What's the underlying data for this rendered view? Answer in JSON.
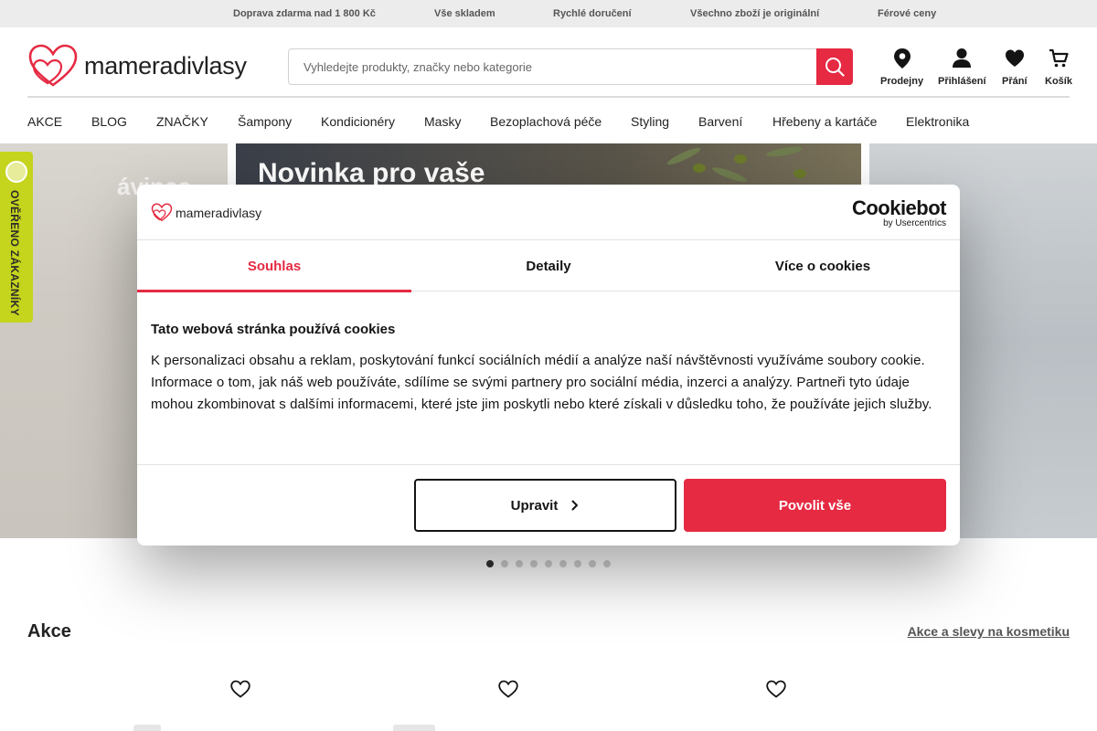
{
  "topbar": {
    "items": [
      "Doprava zdarma nad 1 800 Kč",
      "Vše skladem",
      "Rychlé doručení",
      "Všechno zboží je originální",
      "Férové ceny"
    ]
  },
  "header": {
    "logo_text": "mameradivlasy",
    "search": {
      "placeholder": "Vyhledejte produkty, značky nebo kategorie",
      "value": ""
    },
    "icons": [
      {
        "label": "Prodejny",
        "icon": "location-pin-icon"
      },
      {
        "label": "Přihlášení",
        "icon": "user-icon"
      },
      {
        "label": "Přání",
        "icon": "heart-icon"
      },
      {
        "label": "Košík",
        "icon": "cart-icon"
      }
    ]
  },
  "nav": {
    "items": [
      "AKCE",
      "BLOG",
      "ZNAČKY",
      "Šampony",
      "Kondicionéry",
      "Masky",
      "Bezoplachová péče",
      "Styling",
      "Barvení",
      "Hřebeny a kartáče",
      "Elektronika"
    ]
  },
  "hero": {
    "main_heading": "Novinka pro vaše",
    "left_heading": "ávines",
    "dots_count": 9,
    "active_dot": 0
  },
  "side_badge": {
    "text": "OVĚŘENO ZÁKAZNÍKY"
  },
  "section": {
    "title": "Akce",
    "link": "Akce a slevy na kosmetiku"
  },
  "cookie_dialog": {
    "logo_text": "mameradivlasy",
    "provider_name": "Cookiebot",
    "provider_sub": "by Usercentrics",
    "tabs": [
      "Souhlas",
      "Detaily",
      "Více o cookies"
    ],
    "active_tab": 0,
    "title": "Tato webová stránka používá cookies",
    "text": "K personalizaci obsahu a reklam, poskytování funkcí sociálních médií a analýze naší návštěvnosti využíváme soubory cookie. Informace o tom, jak náš web používáte, sdílíme se svými partnery pro sociální média, inzerci a analýzy. Partneři tyto údaje mohou zkombinovat s dalšími informacemi, které jste jim poskytli nebo které získali v důsledku toho, že používáte jejich služby.",
    "btn_edit": "Upravit",
    "btn_allow": "Povolit vše"
  },
  "colors": {
    "accent": "#e52a42",
    "badge": "#c5d41c",
    "text": "#141414"
  }
}
